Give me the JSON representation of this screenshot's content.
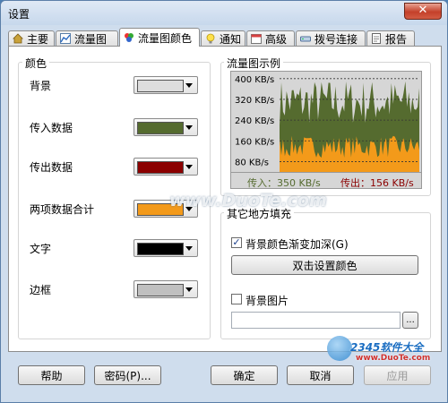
{
  "window": {
    "title": "设置",
    "close_symbol": "✕"
  },
  "tabs": [
    {
      "label": "主要",
      "icon": "home-icon"
    },
    {
      "label": "流量图",
      "icon": "line-chart-icon"
    },
    {
      "label": "流量图颜色",
      "icon": "palette-icon",
      "active": true
    },
    {
      "label": "通知",
      "icon": "lightbulb-icon"
    },
    {
      "label": "高级",
      "icon": "calendar-icon"
    },
    {
      "label": "拨号连接",
      "icon": "modem-icon"
    },
    {
      "label": "报告",
      "icon": "report-icon"
    }
  ],
  "colors_group": {
    "title": "颜色",
    "items": [
      {
        "label": "背景",
        "color": "#dddddd"
      },
      {
        "label": "传入数据",
        "color": "#556b2f"
      },
      {
        "label": "传出数据",
        "color": "#8b0000"
      },
      {
        "label": "两项数据合计",
        "color": "#f39a1a"
      },
      {
        "label": "文字",
        "color": "#000000"
      },
      {
        "label": "边框",
        "color": "#c0c0c0"
      }
    ]
  },
  "preview": {
    "title": "流量图示例",
    "incoming_label": "传入：350 KB/s",
    "outgoing_label": "传出：156 KB/s"
  },
  "chart_data": {
    "type": "area",
    "title": "",
    "ylabel": "",
    "ytick_labels": [
      "400 KB/s",
      "320 KB/s",
      "240 KB/s",
      "160 KB/s",
      "80 KB/s"
    ],
    "yticks": [
      400,
      320,
      240,
      160,
      80
    ],
    "ylim": [
      40,
      420
    ],
    "grid": true,
    "series": [
      {
        "name": "传入",
        "color": "#556b2f",
        "level_low": 220,
        "level_high": 400
      },
      {
        "name": "传出",
        "color": "#f39a1a",
        "level_low": 95,
        "level_high": 180
      }
    ]
  },
  "fill_group": {
    "title": "其它地方填充",
    "gradient_checkbox_label": "背景颜色渐变加深(G)",
    "gradient_checked": true,
    "set_color_button": "双击设置颜色",
    "bg_image_checkbox_label": "背景图片",
    "bg_image_checked": false,
    "bg_image_path": "",
    "browse_button": "..."
  },
  "footer": {
    "help": "帮助",
    "password": "密码(P)...",
    "ok": "确定",
    "cancel": "取消",
    "apply": "应用"
  },
  "watermarks": {
    "center": "www.DuoTe.com",
    "corner_brand": "2345软件大全",
    "corner_url": "www.DuoTe.com"
  }
}
